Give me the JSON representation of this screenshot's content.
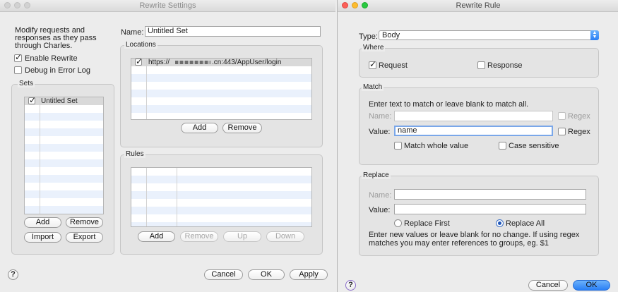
{
  "left_window": {
    "title": "Rewrite Settings",
    "description_line1": "Modify requests and",
    "description_line2": "responses as they pass",
    "description_line3": "through Charles.",
    "enable_rewrite": {
      "label": "Enable Rewrite",
      "checked": true
    },
    "debug_error_log": {
      "label": "Debug in Error Log",
      "checked": false
    },
    "sets": {
      "legend": "Sets",
      "items": [
        {
          "label": "Untitled Set",
          "checked": true
        }
      ],
      "add": "Add",
      "remove": "Remove",
      "import": "Import",
      "export": "Export"
    },
    "name_label": "Name:",
    "name_value": "Untitled Set",
    "locations": {
      "legend": "Locations",
      "rows": [
        {
          "prefix": "https://",
          "suffix": ".cn:443/AppUser/login",
          "checked": true
        }
      ],
      "add": "Add",
      "remove": "Remove"
    },
    "rules": {
      "legend": "Rules",
      "add": "Add",
      "remove": "Remove",
      "up": "Up",
      "down": "Down"
    },
    "help": "?",
    "cancel": "Cancel",
    "ok": "OK",
    "apply": "Apply"
  },
  "right_window": {
    "title": "Rewrite Rule",
    "type_label": "Type:",
    "type_value": "Body",
    "where": {
      "legend": "Where",
      "request": {
        "label": "Request",
        "checked": true
      },
      "response": {
        "label": "Response",
        "checked": false
      }
    },
    "match": {
      "legend": "Match",
      "hint": "Enter text to match or leave blank to match all.",
      "name_label": "Name:",
      "name_value": "",
      "name_regex": "Regex",
      "value_label": "Value:",
      "value_value": "name",
      "value_regex": "Regex",
      "match_whole": "Match whole value",
      "case_sensitive": "Case sensitive"
    },
    "replace": {
      "legend": "Replace",
      "name_label": "Name:",
      "name_value": "",
      "value_label": "Value:",
      "value_value": "",
      "replace_first": "Replace First",
      "replace_all": "Replace All",
      "selected": "replace_all",
      "hint_line1": "Enter new values or leave blank for no change. If using regex",
      "hint_line2": "matches you may enter references to groups, eg. $1"
    },
    "help": "?",
    "cancel": "Cancel",
    "ok": "OK"
  },
  "colors": {
    "window_bg": "#ececec",
    "stripe": "#eaf1fc",
    "accent_blue": "#2a7ff5",
    "focus_ring": "#7aa7e9"
  }
}
